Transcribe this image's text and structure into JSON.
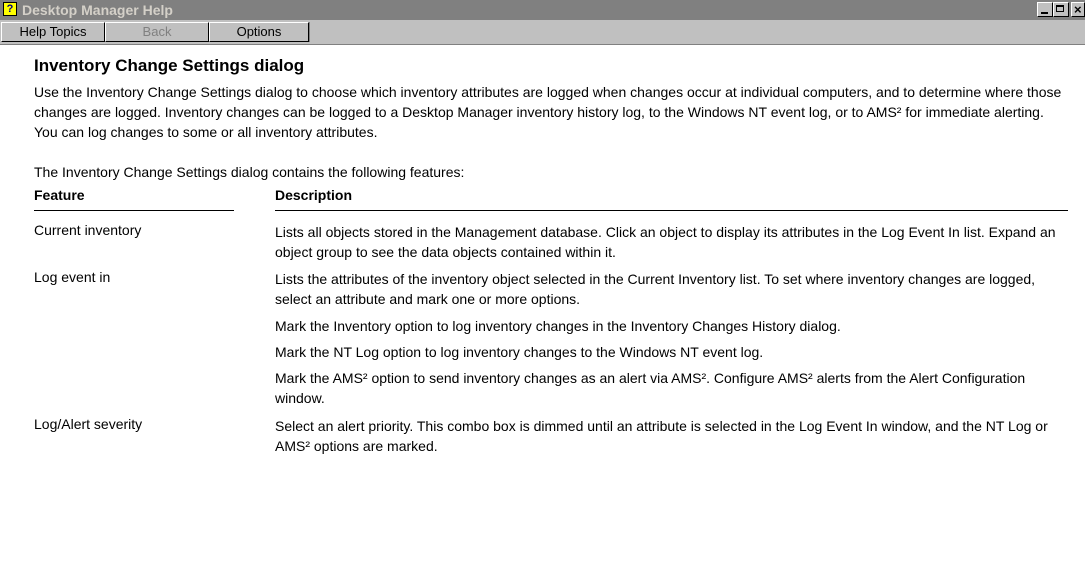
{
  "window": {
    "title": "Desktop Manager Help"
  },
  "toolbar": {
    "help_topics": "Help Topics",
    "back": "Back",
    "options": "Options"
  },
  "content": {
    "heading": "Inventory Change Settings dialog",
    "intro": "Use the Inventory Change Settings dialog to choose which inventory attributes are logged when changes occur at individual computers, and to determine where those changes are logged. Inventory changes can be logged to a Desktop Manager inventory history log, to the Windows NT event log, or to AMS² for immediate alerting. You can log changes to some or all inventory attributes.",
    "features_intro": "The Inventory Change Settings dialog contains the following features:",
    "table": {
      "col_feature": "Feature",
      "col_description": "Description",
      "rows": [
        {
          "feature": "Current inventory",
          "descriptions": [
            "Lists all objects stored in the Management database. Click an object to display its attributes in the Log Event In list. Expand an object group to see the data objects contained within it."
          ]
        },
        {
          "feature": "Log event in",
          "descriptions": [
            "Lists the attributes of the inventory object selected in the Current Inventory list. To set where inventory changes are logged, select an attribute and mark one or more options.",
            "Mark the Inventory option to log inventory changes in the Inventory Changes History dialog.",
            "Mark the NT Log option to log inventory changes to the Windows NT event log.",
            "Mark the AMS² option to send inventory changes as an alert via AMS². Configure AMS² alerts from the Alert Configuration window."
          ]
        },
        {
          "feature": "Log/Alert severity",
          "descriptions": [
            "Select an alert priority. This combo box is dimmed until an attribute is selected in the Log Event In window, and the NT Log or AMS² options are marked."
          ]
        }
      ]
    }
  }
}
